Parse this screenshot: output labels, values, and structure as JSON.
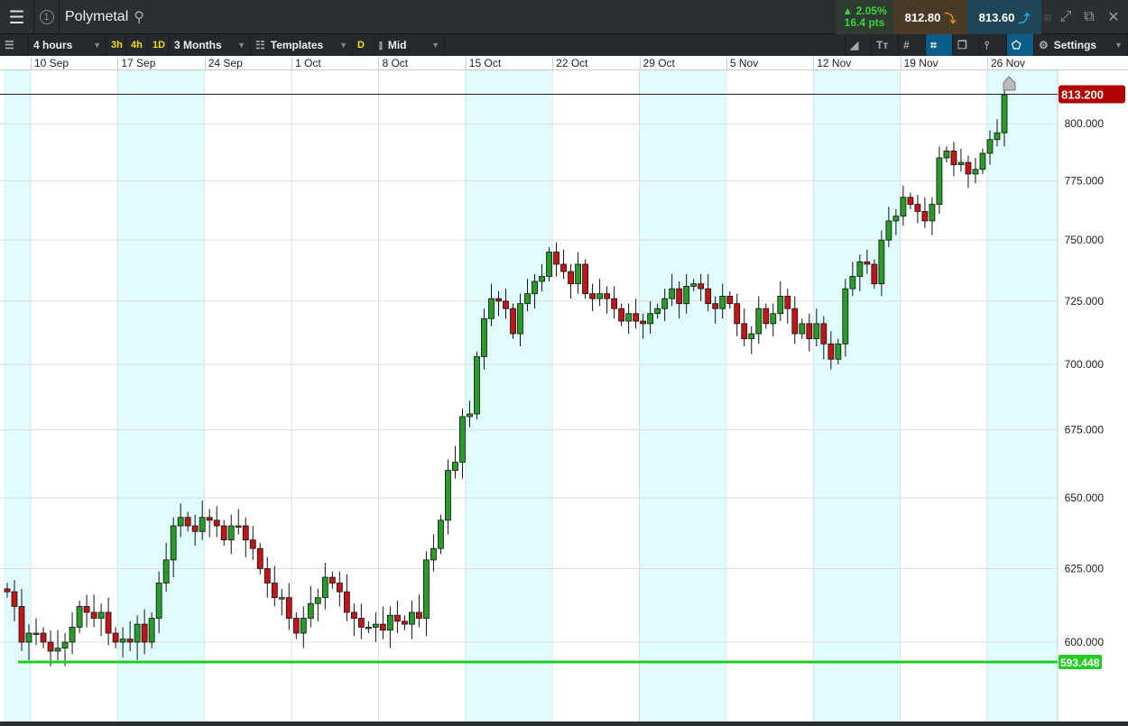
{
  "header": {
    "instrument": "Polymetal",
    "menu_icon": "hamburger-icon",
    "badge": "1",
    "change_pct": "▲ 2.05%",
    "change_pts": "16.4 pts",
    "sell_price": "812.80",
    "buy_price": "813.60"
  },
  "toolbar": {
    "interval": "4 hours",
    "quick": [
      "3h",
      "4h",
      "1D"
    ],
    "range": "3 Months",
    "templates": "Templates",
    "d": "D",
    "price_type": "Mid",
    "settings": "Settings"
  },
  "colors": {
    "up": "#2a9a2a",
    "down": "#c0161a",
    "shade": "#e0fcfd",
    "support": "#22cc22",
    "last": "#b00000"
  },
  "chart_data": {
    "type": "candlestick",
    "scale": "log",
    "x_ticks": [
      "10 Sep",
      "17 Sep",
      "24 Sep",
      "1 Oct",
      "8 Oct",
      "15 Oct",
      "22 Oct",
      "29 Oct",
      "5 Nov",
      "12 Nov",
      "19 Nov",
      "26 Nov"
    ],
    "y_ticks": [
      "800.000",
      "775.000",
      "750.000",
      "725.000",
      "700.000",
      "675.000",
      "650.000",
      "625.000",
      "600.000"
    ],
    "y_tick_values": [
      800,
      775,
      750,
      725,
      700,
      675,
      650,
      625,
      600
    ],
    "ylim": [
      586,
      822
    ],
    "last_price": "813.200",
    "last_price_value": 813.2,
    "support_label": "593.448",
    "support_value": 593.448,
    "close": [
      617,
      612,
      600,
      603,
      603,
      600,
      597,
      598,
      600,
      605,
      612,
      610,
      608,
      610,
      603,
      600,
      601,
      600,
      606,
      600,
      608,
      620,
      628,
      640,
      643,
      640,
      638,
      643,
      642,
      640,
      635,
      640,
      640,
      635,
      632,
      625,
      620,
      615,
      615,
      608,
      603,
      608,
      613,
      615,
      622,
      620,
      617,
      610,
      608,
      605,
      605,
      606,
      604,
      609,
      607,
      606,
      610,
      608,
      628,
      632,
      642,
      660,
      663,
      680,
      681,
      703,
      718,
      726,
      725,
      722,
      712,
      724,
      728,
      733,
      735,
      745,
      740,
      737,
      732,
      740,
      728,
      726,
      728,
      726,
      722,
      717,
      720,
      717,
      716,
      720,
      722,
      726,
      730,
      724,
      731,
      732,
      730,
      724,
      722,
      727,
      724,
      716,
      710,
      712,
      722,
      716,
      720,
      727,
      722,
      712,
      716,
      710,
      716,
      708,
      702,
      708,
      730,
      735,
      741,
      740,
      732,
      750,
      758,
      760,
      768,
      765,
      762,
      758,
      765,
      785,
      788,
      782,
      783,
      778,
      780,
      787,
      793,
      796,
      813
    ]
  }
}
